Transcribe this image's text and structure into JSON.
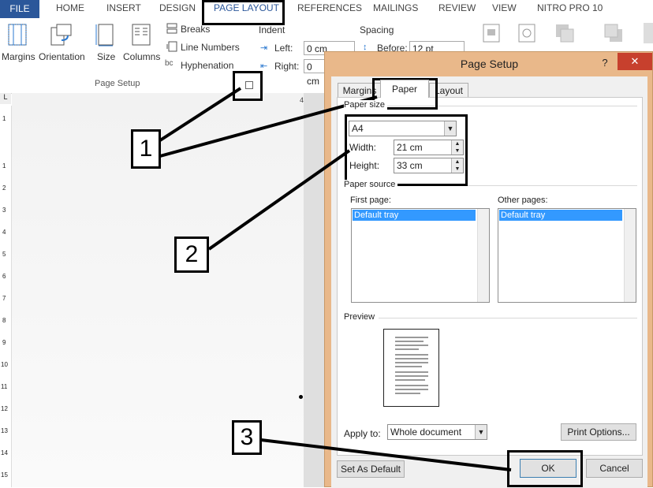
{
  "ribbon": {
    "tabs": {
      "file": "FILE",
      "home": "HOME",
      "insert": "INSERT",
      "design": "DESIGN",
      "page_layout": "PAGE LAYOUT",
      "references": "REFERENCES",
      "mailings": "MAILINGS",
      "review": "REVIEW",
      "view": "VIEW",
      "nitro": "NITRO PRO 10"
    },
    "page_setup": {
      "margins": "Margins",
      "orientation": "Orientation",
      "size": "Size",
      "columns": "Columns",
      "breaks": "Breaks",
      "line_numbers": "Line Numbers",
      "hyphenation": "Hyphenation",
      "group_label": "Page Setup"
    },
    "indent": {
      "label": "Indent",
      "left_label": "Left:",
      "left_value": "0 cm",
      "right_label": "Right:",
      "right_value": "0 cm"
    },
    "spacing": {
      "label": "Spacing",
      "before_label": "Before:",
      "before_value": "12 pt"
    }
  },
  "dialog": {
    "title": "Page Setup",
    "help": "?",
    "close": "✕",
    "tabs": {
      "margins": "Margins",
      "paper": "Paper",
      "layout": "Layout"
    },
    "paper_size": {
      "label": "Paper size",
      "value": "A4",
      "width_label": "Width:",
      "width_value": "21 cm",
      "height_label": "Height:",
      "height_value": "33 cm"
    },
    "paper_source": {
      "label": "Paper source",
      "first_page_label": "First page:",
      "first_page_value": "Default tray",
      "other_pages_label": "Other pages:",
      "other_pages_value": "Default tray"
    },
    "preview": {
      "label": "Preview"
    },
    "apply_to": {
      "label": "Apply to:",
      "value": "Whole document"
    },
    "buttons": {
      "print_options": "Print Options...",
      "set_default": "Set As Default",
      "ok": "OK",
      "cancel": "Cancel"
    }
  },
  "ruler": {
    "top_mark": "4",
    "left_numbers": [
      "1",
      "1",
      "2",
      "3",
      "4",
      "5",
      "6",
      "7",
      "8",
      "9",
      "10",
      "11",
      "12",
      "13",
      "14",
      "15"
    ]
  },
  "callouts": {
    "one": "1",
    "two": "2",
    "three": "3"
  }
}
